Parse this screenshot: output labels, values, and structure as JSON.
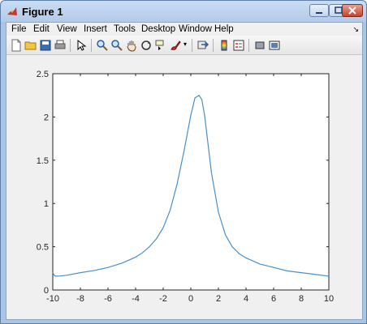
{
  "window": {
    "title": "Figure 1",
    "icon": "matlab-figure-icon"
  },
  "menu": {
    "items": [
      "File",
      "Edit",
      "View",
      "Insert",
      "Tools",
      "Desktop",
      "Window",
      "Help"
    ]
  },
  "toolbar": {
    "buttons": [
      "new-figure-icon",
      "open-file-icon",
      "save-icon",
      "print-icon",
      "pointer-icon",
      "zoom-in-icon",
      "zoom-out-icon",
      "pan-icon",
      "rotate-3d-icon",
      "data-cursor-icon",
      "brush-icon",
      "link-plot-icon",
      "colorbar-icon",
      "legend-icon",
      "hide-plot-tools-icon",
      "show-plot-tools-icon"
    ]
  },
  "colors": {
    "line": "#4a90c8",
    "axes_bg": "#ffffff",
    "figure_bg": "#f0f0f0"
  },
  "chart_data": {
    "type": "line",
    "title": "",
    "xlabel": "",
    "ylabel": "",
    "xlim": [
      -10,
      10
    ],
    "ylim": [
      0,
      2.5
    ],
    "xticks": [
      -10,
      -8,
      -6,
      -4,
      -2,
      0,
      2,
      4,
      6,
      8,
      10
    ],
    "yticks": [
      0,
      0.5,
      1,
      1.5,
      2,
      2.5
    ],
    "xtick_labels": [
      "-10",
      "-8",
      "-6",
      "-4",
      "-2",
      "0",
      "2",
      "4",
      "6",
      "8",
      "10"
    ],
    "ytick_labels": [
      "0",
      "0.5",
      "1",
      "1.5",
      "2",
      "2.5"
    ],
    "grid": false,
    "series": [
      {
        "x": [
          -10,
          -9.9,
          -9.8,
          -9.6,
          -9,
          -8,
          -7,
          -6,
          -5,
          -4,
          -3.5,
          -3,
          -2.5,
          -2,
          -1.5,
          -1,
          -0.5,
          0,
          0.3,
          0.6,
          0.8,
          1,
          1.2,
          1.5,
          2,
          2.5,
          3,
          3.5,
          4,
          5,
          6,
          7,
          8,
          9,
          10
        ],
        "y": [
          0.2,
          0.17,
          0.16,
          0.16,
          0.17,
          0.2,
          0.225,
          0.26,
          0.31,
          0.38,
          0.43,
          0.5,
          0.59,
          0.72,
          0.92,
          1.22,
          1.6,
          2.02,
          2.22,
          2.25,
          2.2,
          2.02,
          1.75,
          1.35,
          0.9,
          0.64,
          0.5,
          0.42,
          0.37,
          0.3,
          0.26,
          0.22,
          0.2,
          0.18,
          0.16
        ]
      }
    ]
  }
}
